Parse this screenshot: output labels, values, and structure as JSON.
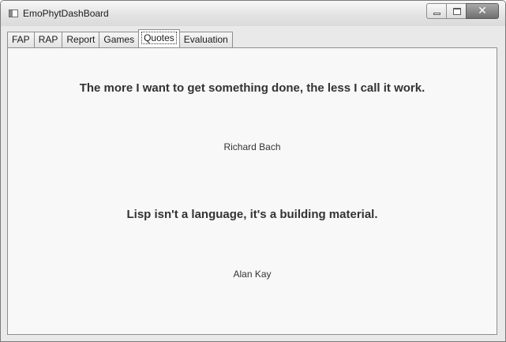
{
  "window": {
    "title": "EmoPhytDashBoard",
    "close_glyph": "✕"
  },
  "tabs": [
    {
      "label": "FAP",
      "selected": false
    },
    {
      "label": "RAP",
      "selected": false
    },
    {
      "label": "Report",
      "selected": false
    },
    {
      "label": "Games",
      "selected": false
    },
    {
      "label": "Quotes",
      "selected": true
    },
    {
      "label": "Evaluation",
      "selected": false
    }
  ],
  "quotes": [
    {
      "text": "The more I want to get something done, the less I call it work.",
      "author": "Richard Bach"
    },
    {
      "text": "Lisp isn't a language, it's a building material.",
      "author": "Alan Kay"
    }
  ],
  "icons": {
    "app": "app-window-icon",
    "minimize": "minimize-icon",
    "maximize": "maximize-icon",
    "close": "close-icon"
  },
  "colors": {
    "content_background": "#f8f8f8",
    "text": "#333333",
    "close_button": "#6f6f6f"
  }
}
